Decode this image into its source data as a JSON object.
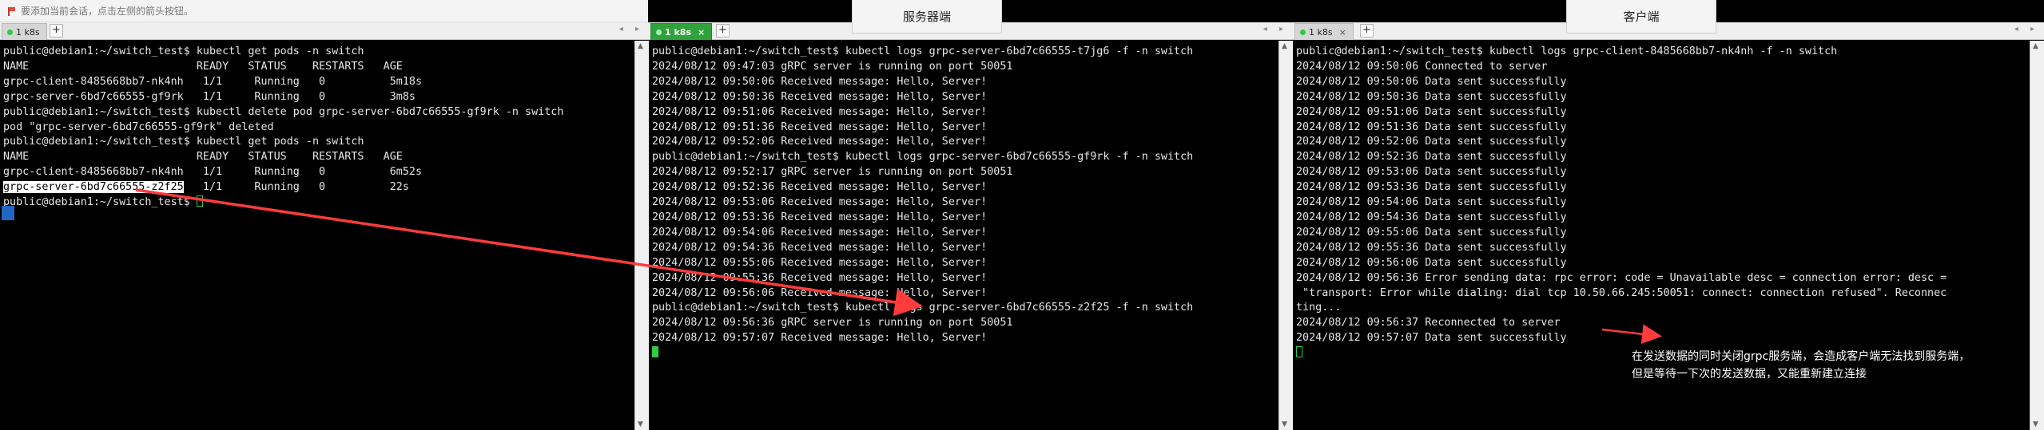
{
  "notification": {
    "text": "要添加当前会话，点击左侧的箭头按钮。"
  },
  "labels": {
    "server": "服务器端",
    "client": "客户端"
  },
  "tabs": {
    "left": "1 k8s",
    "middle": "1 k8s",
    "right": "1 k8s",
    "close": "×",
    "add": "+"
  },
  "nav_arrows": "◂ ▸",
  "terminals": {
    "left": [
      "public@debian1:~/switch_test$ kubectl get pods -n switch",
      "NAME                          READY   STATUS    RESTARTS   AGE",
      "grpc-client-8485668bb7-nk4nh   1/1     Running   0          5m18s",
      "grpc-server-6bd7c66555-gf9rk   1/1     Running   0          3m8s",
      "public@debian1:~/switch_test$ kubectl delete pod grpc-server-6bd7c66555-gf9rk -n switch",
      "pod \"grpc-server-6bd7c66555-gf9rk\" deleted",
      "public@debian1:~/switch_test$ kubectl get pods -n switch",
      "NAME                          READY   STATUS    RESTARTS   AGE",
      "grpc-client-8485668bb7-nk4nh   1/1     Running   0          6m52s"
    ],
    "left_highlight": "grpc-server-6bd7c66555-z2f25",
    "left_highlight_rest": "   1/1     Running   0          22s",
    "left_prompt": "public@debian1:~/switch_test$ ",
    "middle": [
      "public@debian1:~/switch_test$ kubectl logs grpc-server-6bd7c66555-t7jg6 -f -n switch",
      "2024/08/12 09:47:03 gRPC server is running on port 50051",
      "2024/08/12 09:50:06 Received message: Hello, Server!",
      "2024/08/12 09:50:36 Received message: Hello, Server!",
      "2024/08/12 09:51:06 Received message: Hello, Server!",
      "2024/08/12 09:51:36 Received message: Hello, Server!",
      "2024/08/12 09:52:06 Received message: Hello, Server!",
      "public@debian1:~/switch_test$ kubectl logs grpc-server-6bd7c66555-gf9rk -f -n switch",
      "2024/08/12 09:52:17 gRPC server is running on port 50051",
      "2024/08/12 09:52:36 Received message: Hello, Server!",
      "2024/08/12 09:53:06 Received message: Hello, Server!",
      "2024/08/12 09:53:36 Received message: Hello, Server!",
      "2024/08/12 09:54:06 Received message: Hello, Server!",
      "2024/08/12 09:54:36 Received message: Hello, Server!",
      "2024/08/12 09:55:06 Received message: Hello, Server!",
      "2024/08/12 09:55:36 Received message: Hello, Server!",
      "2024/08/12 09:56:06 Received message: Hello, Server!",
      "public@debian1:~/switch_test$ kubectl logs grpc-server-6bd7c66555-z2f25 -f -n switch",
      "2024/08/12 09:56:36 gRPC server is running on port 50051",
      "2024/08/12 09:57:07 Received message: Hello, Server!"
    ],
    "right": [
      "public@debian1:~/switch_test$ kubectl logs grpc-client-8485668bb7-nk4nh -f -n switch",
      "2024/08/12 09:50:06 Connected to server",
      "2024/08/12 09:50:06 Data sent successfully",
      "2024/08/12 09:50:36 Data sent successfully",
      "2024/08/12 09:51:06 Data sent successfully",
      "2024/08/12 09:51:36 Data sent successfully",
      "2024/08/12 09:52:06 Data sent successfully",
      "2024/08/12 09:52:36 Data sent successfully",
      "2024/08/12 09:53:06 Data sent successfully",
      "2024/08/12 09:53:36 Data sent successfully",
      "2024/08/12 09:54:06 Data sent successfully",
      "2024/08/12 09:54:36 Data sent successfully",
      "2024/08/12 09:55:06 Data sent successfully",
      "2024/08/12 09:55:36 Data sent successfully",
      "2024/08/12 09:56:06 Data sent successfully",
      "2024/08/12 09:56:36 Error sending data: rpc error: code = Unavailable desc = connection error: desc =",
      " \"transport: Error while dialing: dial tcp 10.50.66.245:50051: connect: connection refused\". Reconnec",
      "ting...",
      "2024/08/12 09:56:37 Reconnected to server",
      "2024/08/12 09:57:07 Data sent successfully"
    ]
  },
  "annotation": {
    "line1": "在发送数据的同时关闭grpc服务端，会造成客户端无法找到服务端，",
    "line2": "但是等待一下次的发送数据，又能重新建立连接"
  },
  "colors": {
    "arrow": "#ff3b3b",
    "tab_active": "#2fa33b",
    "cursor": "#2ecc40",
    "selection_mark": "#2265c4"
  }
}
